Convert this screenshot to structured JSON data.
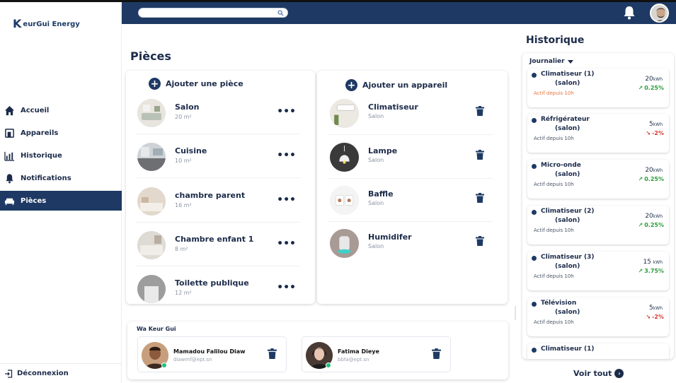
{
  "brand": {
    "logo_letter": "K",
    "name": "eurGui Energy"
  },
  "sidebar": {
    "items": [
      {
        "label": "Accueil",
        "icon": "home-icon"
      },
      {
        "label": "Appareils",
        "icon": "devices-icon"
      },
      {
        "label": "Historique",
        "icon": "chart-icon"
      },
      {
        "label": "Notifications",
        "icon": "bell-icon"
      },
      {
        "label": "Pièces",
        "icon": "sofa-icon",
        "active": true
      }
    ],
    "logout_label": "Déconnexion"
  },
  "topbar": {
    "search_placeholder": "",
    "accent": "#1e3a64"
  },
  "main": {
    "title": "Pièces",
    "rooms": {
      "add_label": "Ajouter une pièce",
      "items": [
        {
          "name": "Salon",
          "area": "20 m²"
        },
        {
          "name": "Cuisine",
          "area": "10 m²"
        },
        {
          "name": "chambre parent",
          "area": "16 m²"
        },
        {
          "name": "Chambre enfant 1",
          "area": "8 m²"
        },
        {
          "name": "Toilette publique",
          "area": "12 m²"
        }
      ]
    },
    "devices": {
      "add_label": "Ajouter un appareil",
      "items": [
        {
          "name": "Climatiseur",
          "room": "Salon"
        },
        {
          "name": "Lampe",
          "room": "Salon"
        },
        {
          "name": "Baffle",
          "room": "Salon"
        },
        {
          "name": "Humidifer",
          "room": "Salon"
        }
      ]
    },
    "contacts": {
      "title": "Wa Keur Gui",
      "items": [
        {
          "name": "Mamadou Falilou Diaw",
          "email": "diawmf@ept.sn"
        },
        {
          "name": "Fatima Dieye",
          "email": "bbfa@ept.sn"
        }
      ]
    }
  },
  "history": {
    "title": "Historique",
    "period": "Journalier",
    "items": [
      {
        "name": "Climatiseur (1)",
        "room": "(salon)",
        "since": "Actif depuis 10h",
        "value": "20",
        "unit": "kWh",
        "trend": "0.25%",
        "direction": "up",
        "since_color": "orange"
      },
      {
        "name": "Réfrigérateur",
        "room": "(salon)",
        "since": "Actif depuis 10h",
        "value": "5",
        "unit": "kWh",
        "trend": "-2%",
        "direction": "down"
      },
      {
        "name": "Micro-onde",
        "room": "(salon)",
        "since": "Actif depuis 10h",
        "value": "20",
        "unit": "kWh",
        "trend": "0.25%",
        "direction": "up"
      },
      {
        "name": "Climatiseur (2)",
        "room": "(salon)",
        "since": "Actif depuis 10h",
        "value": "20",
        "unit": "kWh",
        "trend": "0.25%",
        "direction": "up"
      },
      {
        "name": "Climatiseur (3)",
        "room": "(salon)",
        "since": "Actif depuis 10h",
        "value": "15 ",
        "unit": "kWh",
        "trend": "3.75%",
        "direction": "up"
      },
      {
        "name": "Télévision",
        "room": "(salon)",
        "since": "Actif depuis 10h",
        "value": "5",
        "unit": "kWh",
        "trend": "-2%",
        "direction": "down"
      },
      {
        "name": "Climatiseur (1)",
        "room": "",
        "since": "",
        "value": "",
        "unit": "",
        "trend": "",
        "direction": ""
      }
    ],
    "see_all": "Voir tout"
  }
}
